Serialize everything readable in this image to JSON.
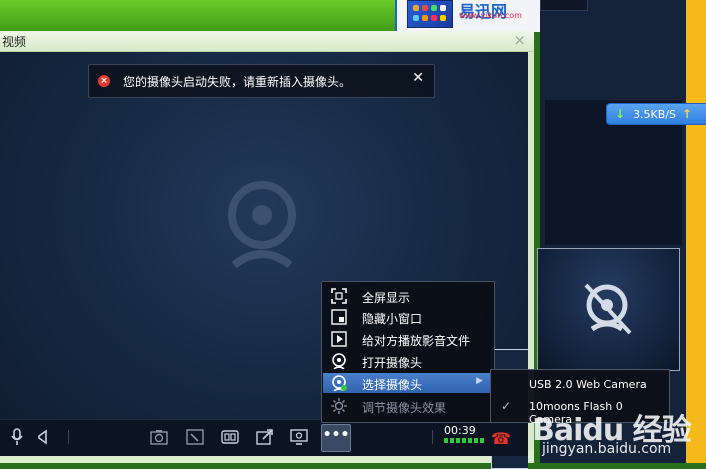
{
  "background": {
    "ad_logo": "易迅网",
    "ad_url": "www.yixun.com"
  },
  "speed_badge": {
    "value": "3.5KB/S"
  },
  "window": {
    "title": "视频",
    "close_glyph": "×"
  },
  "notice": {
    "icon_glyph": "×",
    "message": "您的摄像头启动失败，请重新插入摄像头。",
    "close_glyph": "✕"
  },
  "menu": {
    "items": [
      {
        "label": "全屏显示",
        "icon": "fullscreen-icon"
      },
      {
        "label": "隐藏小窗口",
        "icon": "hide-window-icon"
      },
      {
        "label": "给对方播放影音文件",
        "icon": "play-media-icon"
      },
      {
        "label": "打开摄像头",
        "icon": "camera-icon"
      },
      {
        "label": "选择摄像头",
        "icon": "camera-select-icon",
        "selected": true,
        "has_submenu": true
      },
      {
        "label": "调节摄像头效果",
        "icon": "brightness-icon",
        "disabled": true
      }
    ],
    "submenu_arrow": "▶"
  },
  "submenu": {
    "items": [
      {
        "label": "USB 2.0 Web Camera",
        "checked": false
      },
      {
        "label": "10moons Flash 0 Camera",
        "checked": true
      }
    ],
    "check_glyph": "✓"
  },
  "control_bar": {
    "more_label": "•••",
    "timer": "00:39",
    "hangup_glyph": "☎"
  },
  "watermark": {
    "logo": "Baidu 经验",
    "url": "jingyan.baidu.com"
  },
  "colors": {
    "accent": "#2f63b0",
    "speed_badge": "#2f7fe0",
    "error": "#e23b2e",
    "hangup": "#e2342a",
    "meter": "#2ecc3a"
  }
}
